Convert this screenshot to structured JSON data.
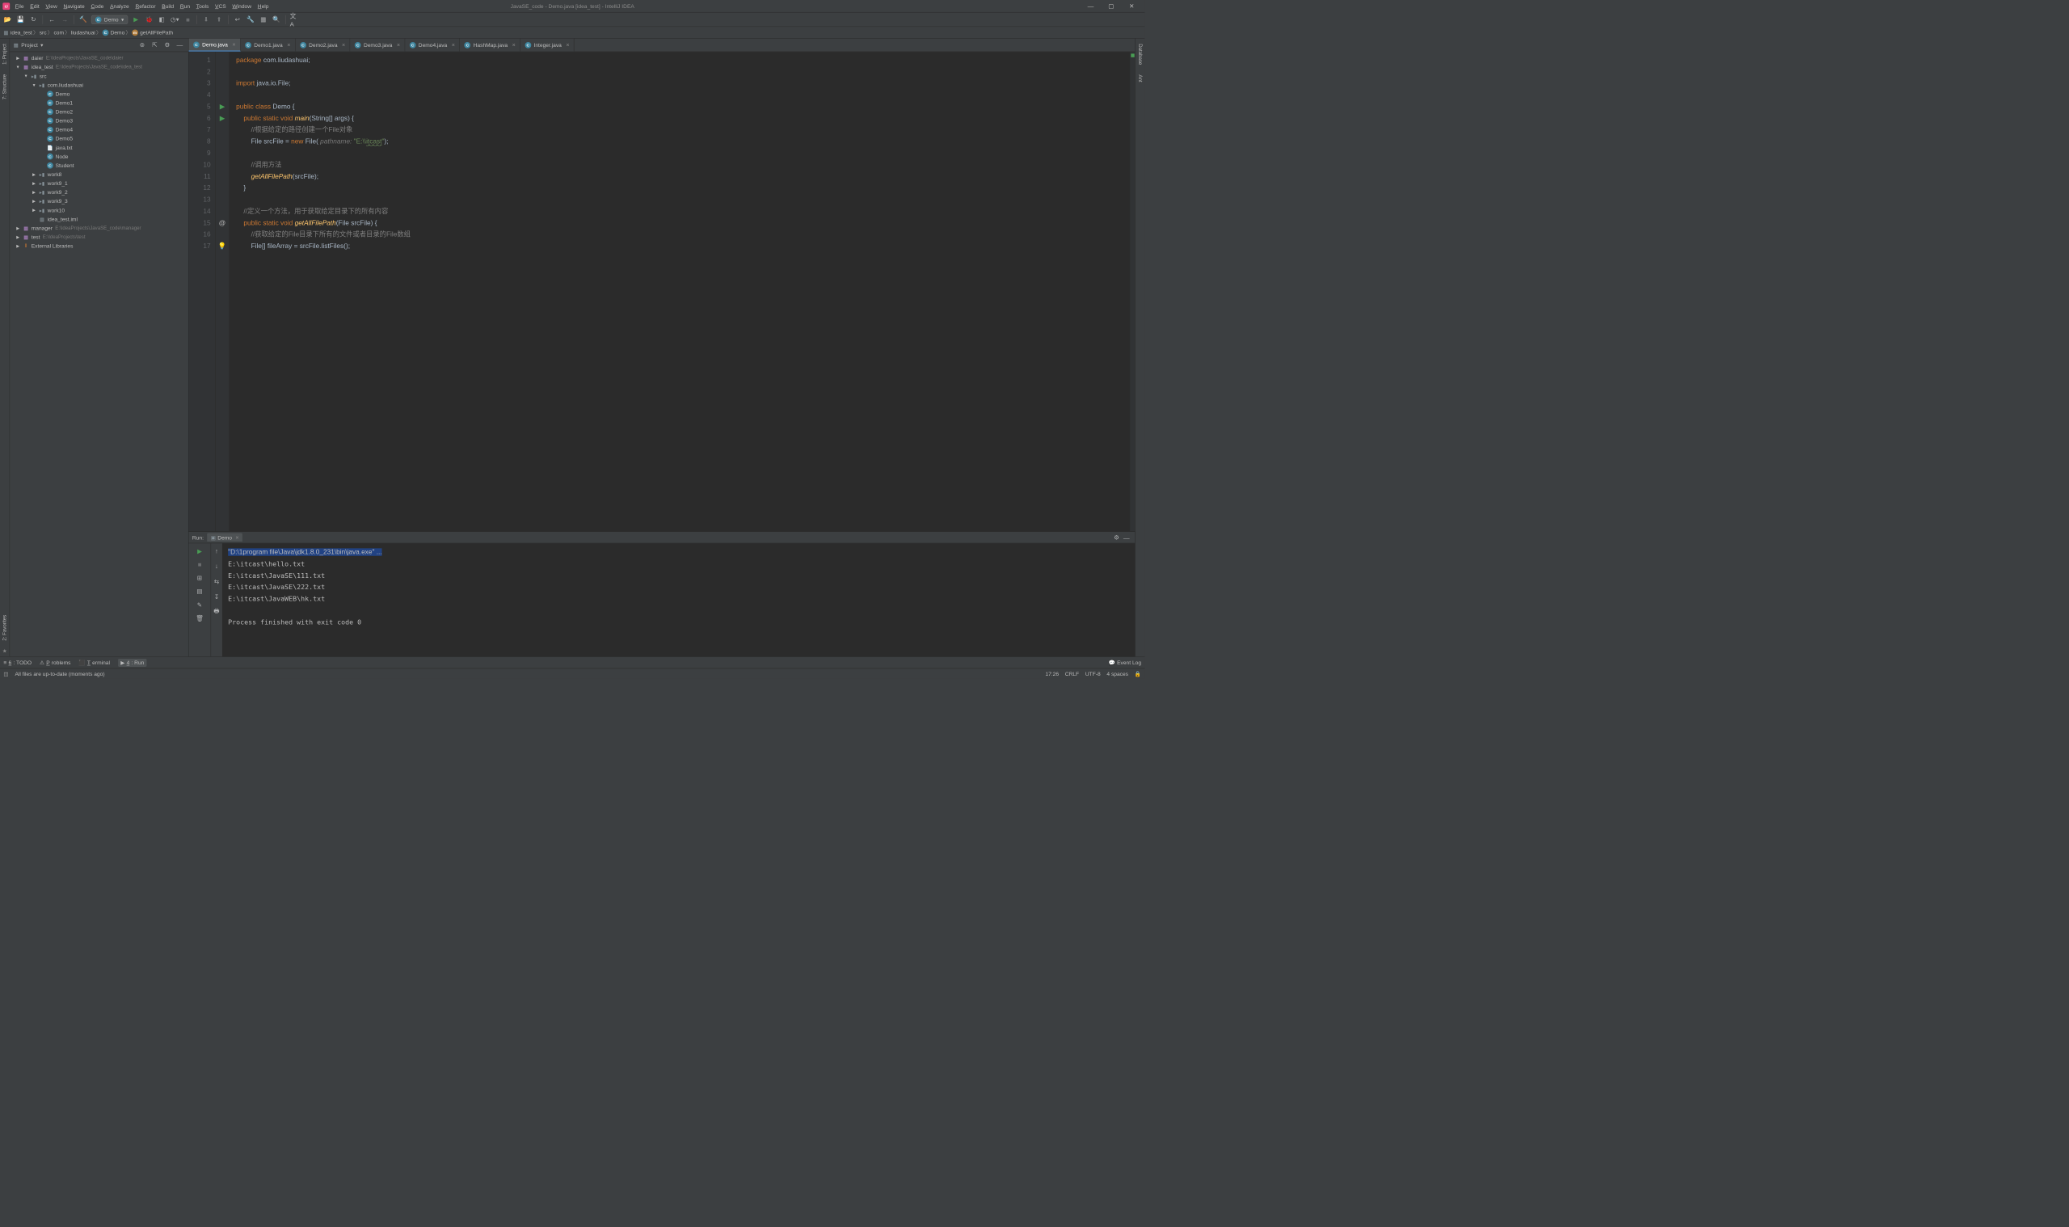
{
  "window": {
    "title": "JavaSE_code - Demo.java [idea_test] - IntelliJ IDEA"
  },
  "menubar": [
    "File",
    "Edit",
    "View",
    "Navigate",
    "Code",
    "Analyze",
    "Refactor",
    "Build",
    "Run",
    "Tools",
    "VCS",
    "Window",
    "Help"
  ],
  "toolbar": {
    "run_config": "Demo"
  },
  "breadcrumbs": [
    "idea_test",
    "src",
    "com",
    "liudashuai",
    "Demo",
    "getAllFilePath"
  ],
  "project_panel": {
    "title": "Project",
    "tree": [
      {
        "indent": 0,
        "arrow": "▶",
        "icon": "mod",
        "label": "daier",
        "hint": "E:\\IdeaProjects\\JavaSE_code\\daier"
      },
      {
        "indent": 0,
        "arrow": "▼",
        "icon": "mod",
        "label": "idea_test",
        "hint": "E:\\IdeaProjects\\JavaSE_code\\idea_test"
      },
      {
        "indent": 1,
        "arrow": "▼",
        "icon": "folder",
        "label": "src",
        "hint": ""
      },
      {
        "indent": 2,
        "arrow": "▼",
        "icon": "folder",
        "label": "com.liudashuai",
        "hint": ""
      },
      {
        "indent": 3,
        "arrow": "",
        "icon": "class",
        "label": "Demo",
        "hint": ""
      },
      {
        "indent": 3,
        "arrow": "",
        "icon": "class",
        "label": "Demo1",
        "hint": ""
      },
      {
        "indent": 3,
        "arrow": "",
        "icon": "class",
        "label": "Demo2",
        "hint": ""
      },
      {
        "indent": 3,
        "arrow": "",
        "icon": "class",
        "label": "Demo3",
        "hint": ""
      },
      {
        "indent": 3,
        "arrow": "",
        "icon": "class",
        "label": "Demo4",
        "hint": ""
      },
      {
        "indent": 3,
        "arrow": "",
        "icon": "class",
        "label": "Demo5",
        "hint": ""
      },
      {
        "indent": 3,
        "arrow": "",
        "icon": "txt",
        "label": "java.txt",
        "hint": ""
      },
      {
        "indent": 3,
        "arrow": "",
        "icon": "class",
        "label": "Node",
        "hint": ""
      },
      {
        "indent": 3,
        "arrow": "",
        "icon": "class",
        "label": "Student",
        "hint": ""
      },
      {
        "indent": 2,
        "arrow": "▶",
        "icon": "folder",
        "label": "work8",
        "hint": ""
      },
      {
        "indent": 2,
        "arrow": "▶",
        "icon": "folder",
        "label": "work9_1",
        "hint": ""
      },
      {
        "indent": 2,
        "arrow": "▶",
        "icon": "folder",
        "label": "work9_2",
        "hint": ""
      },
      {
        "indent": 2,
        "arrow": "▶",
        "icon": "folder",
        "label": "work9_3",
        "hint": ""
      },
      {
        "indent": 2,
        "arrow": "▶",
        "icon": "folder",
        "label": "work10",
        "hint": ""
      },
      {
        "indent": 2,
        "arrow": "",
        "icon": "iml",
        "label": "idea_test.iml",
        "hint": ""
      },
      {
        "indent": 0,
        "arrow": "▶",
        "icon": "mod",
        "label": "manager",
        "hint": "E:\\IdeaProjects\\JavaSE_code\\manager"
      },
      {
        "indent": 0,
        "arrow": "▶",
        "icon": "mod",
        "label": "test",
        "hint": "E:\\IdeaProjects\\test"
      },
      {
        "indent": 0,
        "arrow": "▶",
        "icon": "lib",
        "label": "External Libraries",
        "hint": ""
      }
    ]
  },
  "tabs": [
    {
      "label": "Demo.java",
      "active": true
    },
    {
      "label": "Demo1.java",
      "active": false
    },
    {
      "label": "Demo2.java",
      "active": false
    },
    {
      "label": "Demo3.java",
      "active": false
    },
    {
      "label": "Demo4.java",
      "active": false
    },
    {
      "label": "HashMap.java",
      "active": false
    },
    {
      "label": "Integer.java",
      "active": false
    }
  ],
  "code_lines": [
    {
      "n": 1,
      "g": "",
      "html": "<span class='kw'>package</span> com.liudashuai;"
    },
    {
      "n": 2,
      "g": "",
      "html": ""
    },
    {
      "n": 3,
      "g": "",
      "html": "<span class='kw'>import</span> java.io.File;"
    },
    {
      "n": 4,
      "g": "",
      "html": ""
    },
    {
      "n": 5,
      "g": "▶",
      "html": "<span class='kw'>public class</span> Demo {"
    },
    {
      "n": 6,
      "g": "▶",
      "html": "    <span class='kw'>public static void</span> <span class='fn'>main</span>(String[] args) {"
    },
    {
      "n": 7,
      "g": "",
      "html": "        <span class='cmt'>//根据给定的路径创建一个File对象</span>"
    },
    {
      "n": 8,
      "g": "",
      "html": "        File srcFile = <span class='kw'>new</span> File( <span class='param'>pathname:</span> <span class='str'>\"E:\\\\</span><span class='str2'>itcast</span><span class='str'>\"</span>);"
    },
    {
      "n": 9,
      "g": "",
      "html": ""
    },
    {
      "n": 10,
      "g": "",
      "html": "        <span class='cmt'>//调用方法</span>"
    },
    {
      "n": 11,
      "g": "",
      "html": "        <span class='fn'>getAllFilePath</span>(srcFile);"
    },
    {
      "n": 12,
      "g": "",
      "html": "    }"
    },
    {
      "n": 13,
      "g": "",
      "html": ""
    },
    {
      "n": 14,
      "g": "",
      "html": "    <span class='cmt'>//定义一个方法，用于获取给定目录下的所有内容</span>"
    },
    {
      "n": 15,
      "g": "@",
      "html": "    <span class='kw'>public static void</span> <span class='fn'>getAllFilePath</span>(File srcFile) {"
    },
    {
      "n": 16,
      "g": "",
      "html": "        <span class='cmt'>//获取给定的File目录下所有的文件或者目录的File数组</span>"
    },
    {
      "n": 17,
      "g": "💡",
      "html": "        File[] fileArray = srcFile.listFiles();"
    }
  ],
  "left_rail": [
    "1: Project",
    "7: Structure",
    "2: Favorites"
  ],
  "right_rail": [
    "Database",
    "Ant"
  ],
  "run": {
    "title": "Run:",
    "tab": "Demo",
    "output": [
      {
        "hl": true,
        "text": "\"D:\\1program file\\Java\\jdk1.8.0_231\\bin\\java.exe\" ..."
      },
      {
        "hl": false,
        "text": "E:\\itcast\\hello.txt"
      },
      {
        "hl": false,
        "text": "E:\\itcast\\JavaSE\\111.txt"
      },
      {
        "hl": false,
        "text": "E:\\itcast\\JavaSE\\222.txt"
      },
      {
        "hl": false,
        "text": "E:\\itcast\\JavaWEB\\hk.txt"
      },
      {
        "hl": false,
        "text": ""
      },
      {
        "hl": false,
        "text": "Process finished with exit code 0"
      }
    ]
  },
  "bottom_tabs": [
    {
      "label": "6: TODO",
      "icon": "≡"
    },
    {
      "label": "Problems",
      "icon": "⚠"
    },
    {
      "label": "Terminal",
      "icon": "⬛"
    },
    {
      "label": "4: Run",
      "icon": "▶",
      "active": true
    }
  ],
  "event_log": "Event Log",
  "status": {
    "msg": "All files are up-to-date (moments ago)",
    "time": "17:26",
    "eol": "CRLF",
    "enc": "UTF-8",
    "indent": "4 spaces"
  }
}
